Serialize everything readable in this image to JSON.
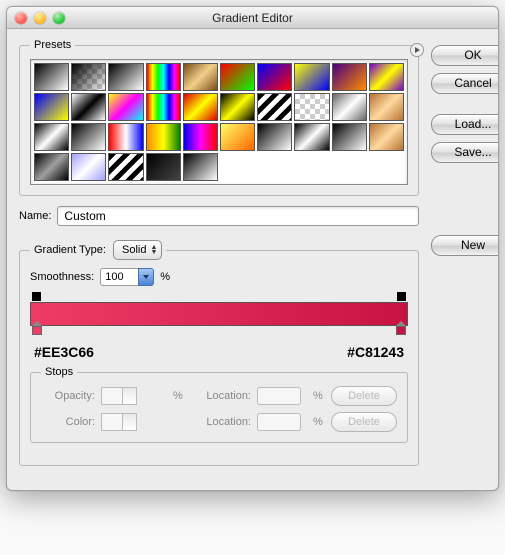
{
  "window": {
    "title": "Gradient Editor"
  },
  "right_buttons": {
    "ok": "OK",
    "cancel": "Cancel",
    "load": "Load...",
    "save": "Save...",
    "new": "New"
  },
  "presets": {
    "legend": "Presets",
    "swatches": [
      "linear-gradient(135deg,#000,#fff)",
      "checker-fade",
      "linear-gradient(135deg,#000,#fff)",
      "linear-gradient(90deg,#ff0000,#ffff00,#00ff00,#00ffff,#0000ff,#ff00ff,#ff0000)",
      "linear-gradient(135deg,#7a4a1a,#f3d08a,#7a4a1a)",
      "linear-gradient(135deg,#f00,#0f0)",
      "linear-gradient(135deg,#00f,#f00)",
      "linear-gradient(135deg,#ff0,#00f)",
      "linear-gradient(135deg,#4a0080,#ff8c00)",
      "linear-gradient(135deg,#70c,#ffff00,#70c)",
      "linear-gradient(135deg,#00f,#ff0)",
      "linear-gradient(135deg,#fff,#000,#fff)",
      "linear-gradient(135deg,#ffff00,#ff00ff,#00ffff)",
      "linear-gradient(90deg,#ff0000,#ffff00,#00ff00,#00ffff,#0000ff,#ff00ff,#ff0000)",
      "linear-gradient(135deg,#d00,#ff0,#d00)",
      "linear-gradient(135deg,#000,#ff0,#000)",
      "repeating-linear-gradient(135deg,#000 0 5px,#fff 5px 10px)",
      "checker",
      "linear-gradient(135deg,#666,#fff,#666)",
      "linear-gradient(135deg,#b87333,#ffd9a0,#b87333)",
      "linear-gradient(135deg,#000,#fff,#000)",
      "linear-gradient(135deg,#000,#fff)",
      "linear-gradient(90deg,#f00,#fff,#00f)",
      "linear-gradient(90deg,#ff8c00,#ff0,#008000)",
      "linear-gradient(90deg,#00f,#f0f,#f00)",
      "linear-gradient(135deg,#ffff66,#ff6600)",
      "linear-gradient(135deg,#000,#fff)",
      "linear-gradient(135deg,#000,#fff,#000)",
      "linear-gradient(135deg,#000,#fff)",
      "linear-gradient(135deg,#b87333,#ffd9a0,#b87333)",
      "linear-gradient(135deg,#000,#a0a0a0,#000)",
      "linear-gradient(135deg,#a0a0ff,#fff,#a0a0ff)",
      "repeating-linear-gradient(135deg,#000 0 5px,#fff 5px 10px)",
      "linear-gradient(135deg,#000,#444)",
      "linear-gradient(135deg,#000,#fff)"
    ]
  },
  "name": {
    "label": "Name:",
    "value": "Custom"
  },
  "type": {
    "label": "Gradient Type:",
    "value": "Solid"
  },
  "smoothness": {
    "label": "Smoothness:",
    "value": "100",
    "unit": "%"
  },
  "gradient": {
    "left_hex": "#EE3C66",
    "right_hex": "#C81243",
    "css": "linear-gradient(90deg,#ee3c66,#c81243)"
  },
  "stops": {
    "legend": "Stops",
    "opacity_label": "Opacity:",
    "opacity_value": "",
    "opacity_unit": "%",
    "opacity_loc_label": "Location:",
    "opacity_loc_value": "",
    "opacity_loc_unit": "%",
    "opacity_delete": "Delete",
    "color_label": "Color:",
    "color_loc_label": "Location:",
    "color_loc_value": "",
    "color_loc_unit": "%",
    "color_delete": "Delete"
  },
  "chart_data": {
    "type": "gradient",
    "stops": [
      {
        "position": 0,
        "color": "#EE3C66",
        "opacity": 100
      },
      {
        "position": 100,
        "color": "#C81243",
        "opacity": 100
      }
    ],
    "smoothness": 100,
    "gradient_type": "Solid"
  }
}
